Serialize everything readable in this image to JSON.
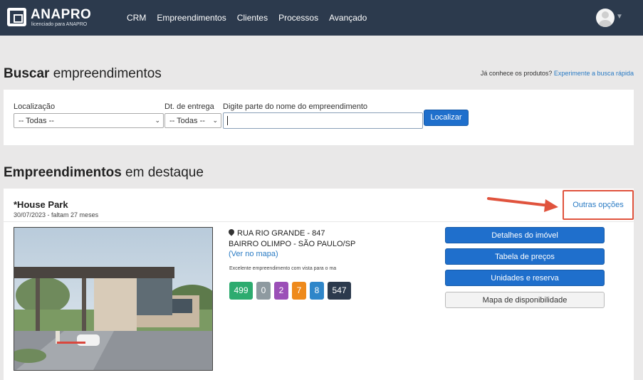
{
  "navbar": {
    "logo_title": "ANAPRO",
    "logo_subtitle": "licenciado para ANAPRO",
    "menu": [
      "CRM",
      "Empreendimentos",
      "Clientes",
      "Processos",
      "Avançado"
    ],
    "avatar_icon": "user-avatar-icon"
  },
  "search": {
    "heading_bold": "Buscar",
    "heading_rest": " empreendimentos",
    "quick_prefix": "Já conhece os produtos?",
    "quick_link": "Experimente a busca rápida",
    "location_label": "Localização",
    "location_value": "-- Todas --",
    "delivery_label": "Dt. de entrega",
    "delivery_value": "-- Todas --",
    "name_label": "Digite parte do nome do empreendimento",
    "name_value": "",
    "locate_button": "Localizar"
  },
  "featured": {
    "heading_bold": "Empreendimentos",
    "heading_rest": " em destaque",
    "card": {
      "title": "*House Park",
      "subtitle": "30/07/2023 - faltam 27 meses",
      "other_options": "Outras opções",
      "address_line1": "RUA RIO GRANDE - 847",
      "address_line2": "BAIRRO OLIMPO - SÃO PAULO/SP",
      "map_link": "(Ver no mapa)",
      "description": "Excelente empreendimento com vista para o ma",
      "badges": [
        {
          "value": "499",
          "color": "#2dab6f"
        },
        {
          "value": "0",
          "color": "#8e9aa0"
        },
        {
          "value": "2",
          "color": "#9b4fb7"
        },
        {
          "value": "7",
          "color": "#ee8a1c"
        },
        {
          "value": "8",
          "color": "#2f86c9"
        },
        {
          "value": "547",
          "color": "#2c3a4d"
        }
      ],
      "actions": [
        "Detalhes do imóvel",
        "Tabela de preços",
        "Unidades e reserva",
        "Mapa de disponibilidade"
      ]
    }
  },
  "colors": {
    "navbar": "#2c3a4d",
    "primary_button": "#1f6fcc",
    "link": "#2a7bc4",
    "highlight": "#e0533d"
  }
}
